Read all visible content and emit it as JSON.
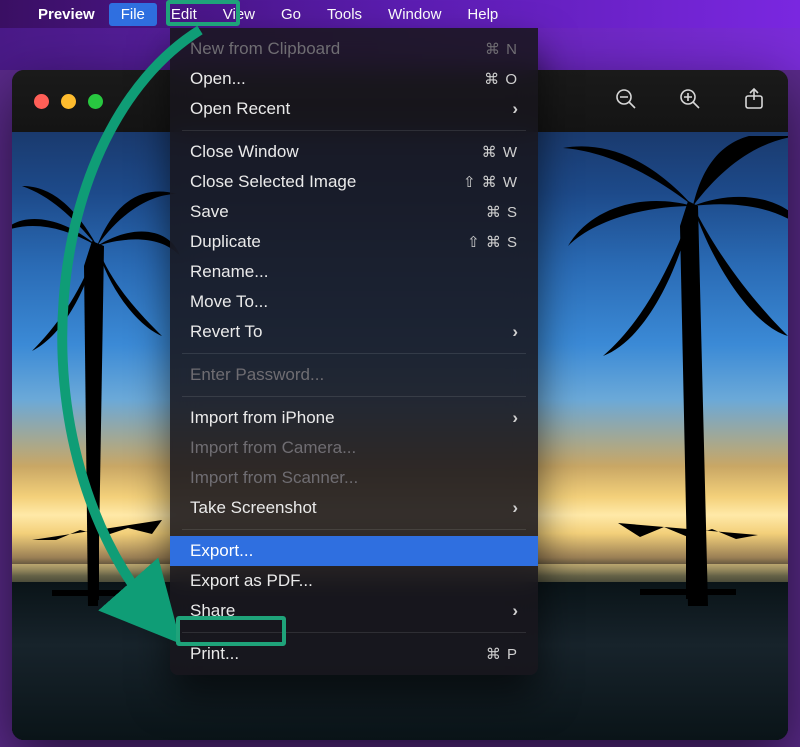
{
  "menubar": {
    "app": "Preview",
    "items": [
      "File",
      "Edit",
      "View",
      "Go",
      "Tools",
      "Window",
      "Help"
    ],
    "active_index": 0
  },
  "toolbar": {
    "zoom_out": "zoom-out",
    "zoom_in": "zoom-in",
    "share": "share"
  },
  "menu": {
    "sections": [
      [
        {
          "label": "New from Clipboard",
          "shortcut": "⌘ N",
          "disabled": true
        },
        {
          "label": "Open...",
          "shortcut": "⌘ O"
        },
        {
          "label": "Open Recent",
          "submenu": true
        }
      ],
      [
        {
          "label": "Close Window",
          "shortcut": "⌘ W"
        },
        {
          "label": "Close Selected Image",
          "shortcut": "⇧ ⌘ W"
        },
        {
          "label": "Save",
          "shortcut": "⌘ S"
        },
        {
          "label": "Duplicate",
          "shortcut": "⇧ ⌘ S"
        },
        {
          "label": "Rename..."
        },
        {
          "label": "Move To..."
        },
        {
          "label": "Revert To",
          "submenu": true
        }
      ],
      [
        {
          "label": "Enter Password...",
          "disabled": true
        }
      ],
      [
        {
          "label": "Import from iPhone",
          "submenu": true
        },
        {
          "label": "Import from Camera...",
          "disabled": true
        },
        {
          "label": "Import from Scanner...",
          "disabled": true
        },
        {
          "label": "Take Screenshot",
          "submenu": true
        }
      ],
      [
        {
          "label": "Export...",
          "highlighted": true
        },
        {
          "label": "Export as PDF..."
        },
        {
          "label": "Share",
          "submenu": true
        }
      ],
      [
        {
          "label": "Print...",
          "shortcut": "⌘ P"
        }
      ]
    ]
  },
  "annotation": {
    "highlight_file": true,
    "highlight_export": true,
    "arrow_color": "#0f9d76"
  }
}
